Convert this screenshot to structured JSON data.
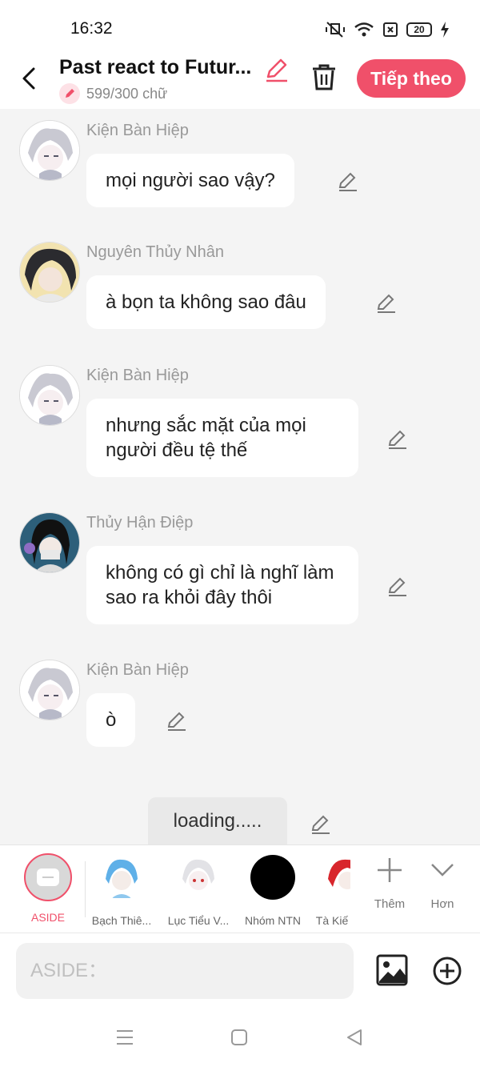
{
  "status": {
    "time": "16:32",
    "battery": "20"
  },
  "header": {
    "title": "Past react to Futur...",
    "word_count": "599/300 chữ",
    "next_label": "Tiếp theo"
  },
  "messages": [
    {
      "name": "Kiện Bàn Hiệp",
      "text": "mọi người sao vậy?"
    },
    {
      "name": "Nguyên Thủy Nhân",
      "text": "à bọn ta không sao đâu"
    },
    {
      "name": "Kiện Bàn Hiệp",
      "text": "nhưng sắc mặt của mọi người đều tệ thế"
    },
    {
      "name": "Thủy Hận Điệp",
      "text": "không có gì chỉ là nghĩ làm sao ra khỏi đây thôi"
    },
    {
      "name": "Kiện Bàn Hiệp",
      "text": "ò"
    }
  ],
  "narration": {
    "text": "loading....."
  },
  "characters": [
    {
      "label": "ASIDE"
    },
    {
      "label": "Bạch Thiê..."
    },
    {
      "label": "Lục Tiểu V..."
    },
    {
      "label": "Nhóm NTN"
    },
    {
      "label": "Tà Kiế"
    }
  ],
  "strip_actions": {
    "more_label": "Thêm",
    "expand_label": "Hơn"
  },
  "input": {
    "placeholder": "ASIDE："
  },
  "colors": {
    "accent": "#f0506a",
    "background": "#f4f4f4"
  }
}
